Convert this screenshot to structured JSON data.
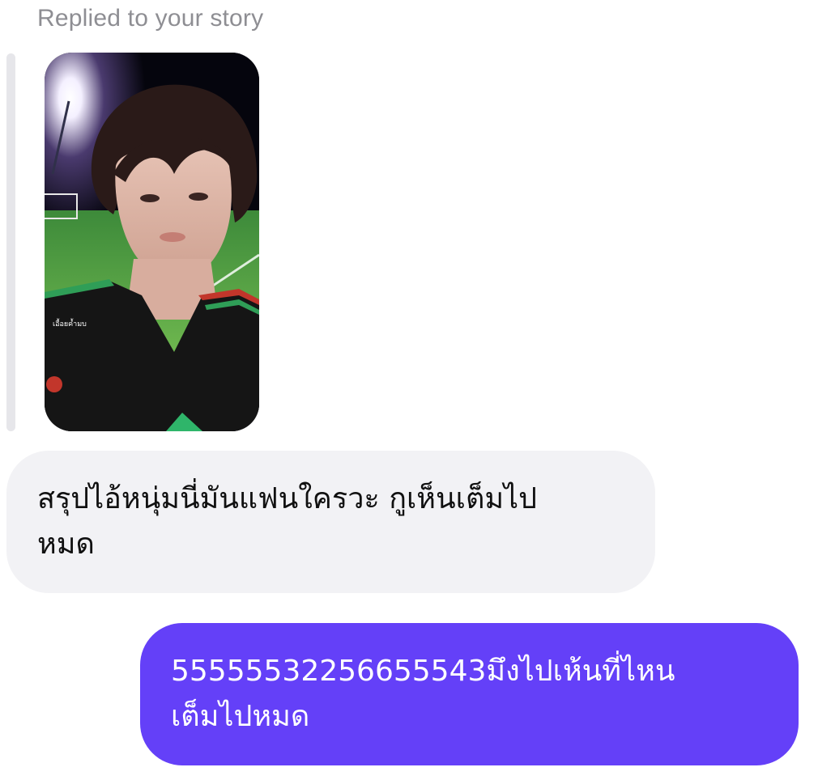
{
  "reply_caption": "Replied to your story",
  "story": {
    "overlay_text": "เอื้อยค้ำมบ"
  },
  "messages": [
    {
      "direction": "incoming",
      "lines": [
        "สรุปไอ้หนุ่มนี่มันแฟนใครวะ กูเห็นเต็มไป",
        "หมด"
      ]
    },
    {
      "direction": "outgoing",
      "lines": [
        "5555553225665554​3มึงไปเห้นที่ไหน",
        "เต็มไปหมด"
      ]
    }
  ],
  "colors": {
    "incoming_bubble": "#f2f2f5",
    "outgoing_bubble": "#6440f8",
    "caption": "#8e8e93"
  }
}
